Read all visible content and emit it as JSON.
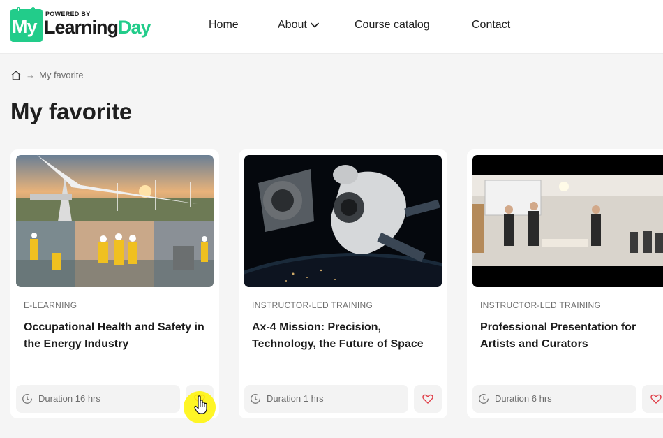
{
  "header": {
    "logo": {
      "powered": "POWERED BY",
      "my": "My",
      "learning": "Learning",
      "day": "Day"
    },
    "nav": [
      {
        "label": "Home"
      },
      {
        "label": "About",
        "has_dropdown": true
      },
      {
        "label": "Course catalog"
      },
      {
        "label": "Contact"
      }
    ]
  },
  "breadcrumb": {
    "home_icon": "home-icon",
    "separator": "→",
    "current": "My favorite"
  },
  "page_title": "My favorite",
  "cards": [
    {
      "type": "E-LEARNING",
      "title": "Occupational Health and Safety in the Energy Industry",
      "duration": "Duration 16 hrs",
      "favorite": true
    },
    {
      "type": "INSTRUCTOR-LED TRAINING",
      "title": "Ax-4 Mission: Precision, Technology, the Future of Space",
      "duration": "Duration 1 hrs",
      "favorite": true
    },
    {
      "type": "INSTRUCTOR-LED TRAINING",
      "title": "Professional Presentation for Artists and Curators",
      "duration": "Duration 6 hrs",
      "favorite": true
    }
  ],
  "colors": {
    "brand_green": "#22cc8a",
    "heart_red": "#e0404a",
    "cursor_highlight": "#fff500"
  }
}
